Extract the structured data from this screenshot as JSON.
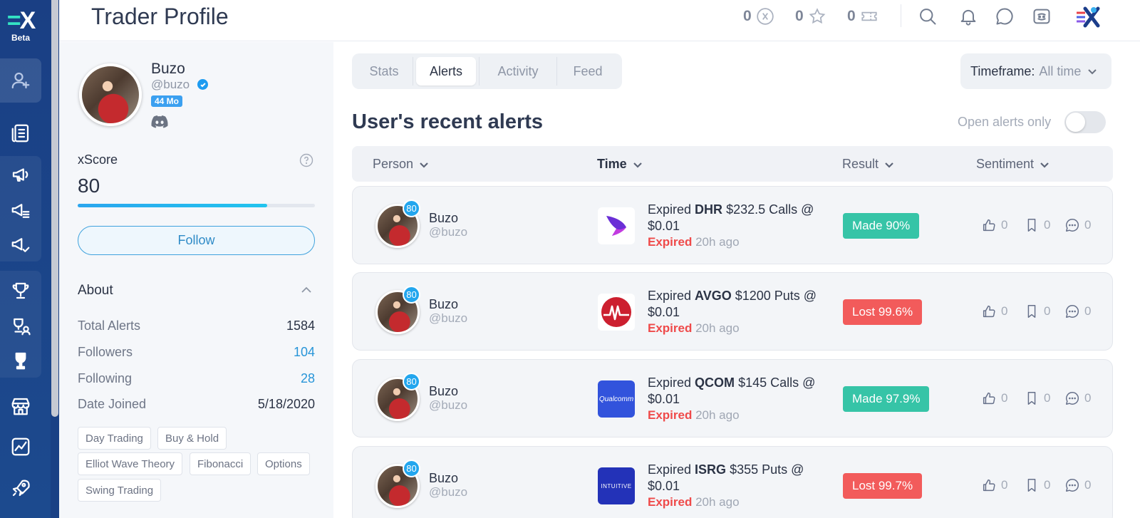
{
  "app": {
    "logo_text": "X",
    "beta_label": "Beta",
    "page_title": "Trader Profile"
  },
  "header": {
    "counters": [
      {
        "icon": "x-coin-icon",
        "value": "0"
      },
      {
        "icon": "star-icon",
        "value": "0"
      },
      {
        "icon": "ticket-icon",
        "value": "0"
      }
    ],
    "icons": [
      "search-icon",
      "bell-icon",
      "chat-icon",
      "discord-icon"
    ]
  },
  "profile": {
    "name": "Buzo",
    "handle": "@buzo",
    "tenure": "44 Mo",
    "xscore_label": "xScore",
    "xscore_value": "80",
    "xscore_fraction": 0.8,
    "follow_label": "Follow",
    "about_label": "About",
    "stats": [
      {
        "label": "Total Alerts",
        "value": "1584",
        "link": false
      },
      {
        "label": "Followers",
        "value": "104",
        "link": true
      },
      {
        "label": "Following",
        "value": "28",
        "link": true
      },
      {
        "label": "Date Joined",
        "value": "5/18/2020",
        "link": false
      }
    ],
    "tags": [
      "Day Trading",
      "Buy & Hold",
      "Elliot Wave Theory",
      "Fibonacci",
      "Options",
      "Swing Trading"
    ]
  },
  "main": {
    "tabs": [
      {
        "label": "Stats",
        "active": false
      },
      {
        "label": "Alerts",
        "active": true
      },
      {
        "label": "Activity",
        "active": false
      },
      {
        "label": "Feed",
        "active": false
      }
    ],
    "timeframe_label": "Timeframe:",
    "timeframe_value": "All time",
    "section_title": "User's recent alerts",
    "open_alerts_label": "Open alerts only",
    "open_alerts_on": false,
    "columns": [
      "Person",
      "Time",
      "Result",
      "Sentiment"
    ],
    "alerts": [
      {
        "score": "80",
        "name": "Buzo",
        "handle": "@buzo",
        "prefix": "Expired",
        "ticker": "DHR",
        "detail": "$232.5 Calls @",
        "price": "$0.01",
        "status": "Expired",
        "time": "20h ago",
        "result": "Made 90%",
        "outcome": "win",
        "likes": "0",
        "saves": "0",
        "comments": "0"
      },
      {
        "score": "80",
        "name": "Buzo",
        "handle": "@buzo",
        "prefix": "Expired",
        "ticker": "AVGO",
        "detail": "$1200 Puts @",
        "price": "$0.01",
        "status": "Expired",
        "time": "20h ago",
        "result": "Lost 99.6%",
        "outcome": "loss",
        "likes": "0",
        "saves": "0",
        "comments": "0"
      },
      {
        "score": "80",
        "name": "Buzo",
        "handle": "@buzo",
        "prefix": "Expired",
        "ticker": "QCOM",
        "detail": "$145 Calls @",
        "price": "$0.01",
        "status": "Expired",
        "time": "20h ago",
        "result": "Made 97.9%",
        "outcome": "win",
        "likes": "0",
        "saves": "0",
        "comments": "0"
      },
      {
        "score": "80",
        "name": "Buzo",
        "handle": "@buzo",
        "prefix": "Expired",
        "ticker": "ISRG",
        "detail": "$355 Puts @",
        "price": "$0.01",
        "status": "Expired",
        "time": "20h ago",
        "result": "Lost 99.7%",
        "outcome": "loss",
        "likes": "0",
        "saves": "0",
        "comments": "0"
      }
    ],
    "logo_texts": [
      "",
      "",
      "Qualcomm",
      "INTUITIVE"
    ]
  },
  "colors": {
    "sidebar": "#1a3f84",
    "accent": "#2795d8",
    "win": "#36c4a7",
    "loss": "#f25b5b"
  }
}
